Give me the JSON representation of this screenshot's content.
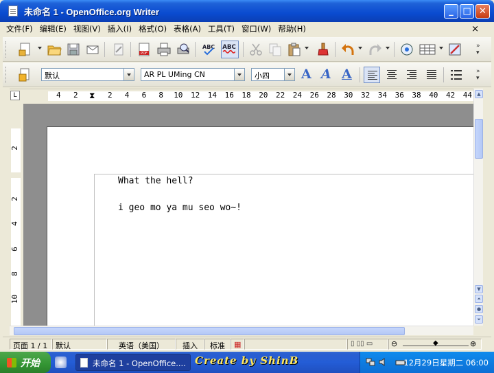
{
  "window": {
    "title": "未命名 1 - OpenOffice.org Writer",
    "minimize": "_",
    "maximize": "□",
    "close": "✕"
  },
  "menu": {
    "items": [
      "文件(F)",
      "编辑(E)",
      "视图(V)",
      "插入(I)",
      "格式(O)",
      "表格(A)",
      "工具(T)",
      "窗口(W)",
      "帮助(H)"
    ],
    "close_doc": "×"
  },
  "format_bar": {
    "style": "默认",
    "font": "AR PL UMing CN",
    "size": "小四",
    "bold": "A",
    "italic": "A",
    "underline": "A"
  },
  "ruler": {
    "corner": "L",
    "left_numbers": [
      "4",
      "2"
    ],
    "right_numbers": [
      "2",
      "4",
      "6",
      "8",
      "10",
      "12",
      "14",
      "16",
      "18",
      "20",
      "22",
      "24",
      "26",
      "28",
      "30",
      "32",
      "34",
      "36",
      "38",
      "40",
      "42",
      "44"
    ],
    "vertical_numbers": [
      "2",
      "2",
      "4",
      "6",
      "8",
      "10"
    ]
  },
  "document": {
    "lines": [
      "What the hell?",
      "i geo mo ya mu seo wo~!"
    ]
  },
  "statusbar": {
    "page": "页面 1 / 1",
    "style": "默认",
    "language": "英语（美国）",
    "insert_mode": "插入",
    "selection_mode": "标准"
  },
  "taskbar": {
    "start": "开始",
    "task": "未命名 1 - OpenOffice....",
    "watermark": "Create by ShinB",
    "clock": "12月29日星期二 06:00"
  },
  "colors": {
    "title_blue": "#0a4bd0",
    "taskbar_blue": "#245dd6",
    "start_green": "#339533"
  },
  "icons": [
    "document-icon",
    "new-document-icon",
    "open-folder-icon",
    "save-icon",
    "email-icon",
    "edit-file-icon",
    "export-pdf-icon",
    "print-icon",
    "print-preview-icon",
    "spellcheck-icon",
    "autospellcheck-icon",
    "cut-icon",
    "copy-icon",
    "paste-icon",
    "format-paintbrush-icon",
    "undo-icon",
    "redo-icon",
    "navigator-icon",
    "table-icon",
    "draw-functions-icon",
    "styles-icon",
    "bold-icon",
    "italic-icon",
    "underline-icon",
    "align-left-icon",
    "align-center-icon",
    "align-right-icon",
    "justify-icon",
    "numbering-icon"
  ]
}
